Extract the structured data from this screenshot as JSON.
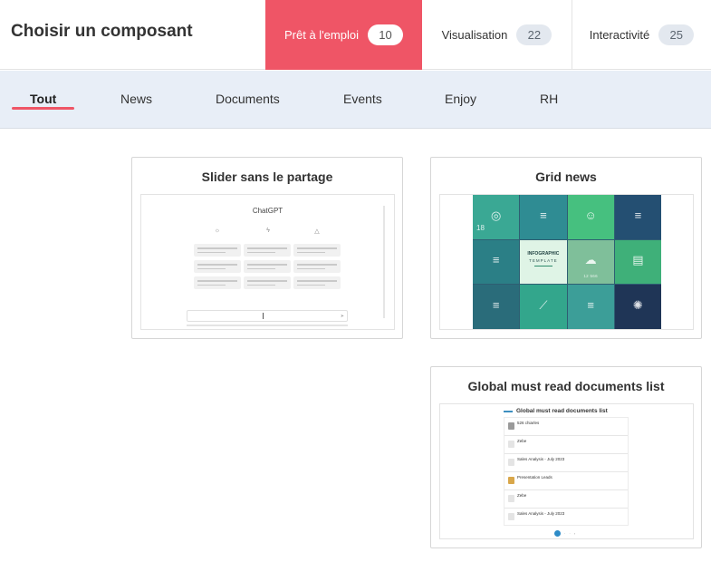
{
  "header": {
    "title": "Choisir un composant",
    "tabs": [
      {
        "label": "Prêt à l'emploi",
        "count": "10",
        "active": true
      },
      {
        "label": "Visualisation",
        "count": "22",
        "active": false
      },
      {
        "label": "Interactivité",
        "count": "25",
        "active": false
      }
    ]
  },
  "categories": {
    "items": [
      "Tout",
      "News",
      "Documents",
      "Events",
      "Enjoy",
      "RH"
    ],
    "active": "Tout"
  },
  "cards": [
    {
      "title": "Slider sans le partage",
      "preview": {
        "app_title": "ChatGPT",
        "column_icons": [
          "sun-icon",
          "lightning-icon",
          "warning-icon"
        ]
      }
    },
    {
      "title": "Grid news",
      "preview": {
        "center_heading": "INFOGRAPHIC",
        "center_sub": "TEMPLATE",
        "number_a": "18",
        "number_b": "12 566"
      }
    },
    {
      "title": "Global must read documents list",
      "preview": {
        "heading": "Global must read documents list",
        "rows": [
          "526 chiarles",
          "Zebe",
          "Sales Analysis - July 2023",
          "Presentation Leads",
          "Zebe",
          "Sales Analysis - July 2023"
        ]
      }
    }
  ],
  "colors": {
    "accent": "#ef5566",
    "nav_bg": "#e8eef7",
    "badge_bg": "#e3e8ef"
  }
}
